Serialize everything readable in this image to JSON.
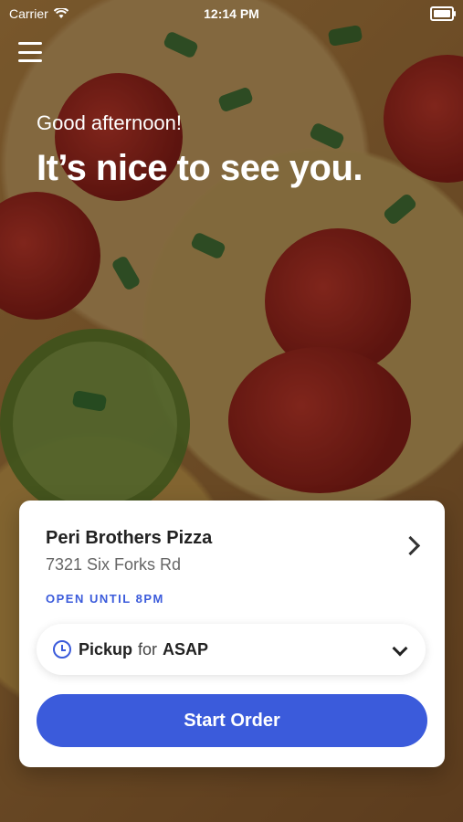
{
  "status_bar": {
    "carrier": "Carrier",
    "time": "12:14 PM"
  },
  "greeting": "Good afternoon!",
  "headline": "It’s nice to see you.",
  "store": {
    "name": "Peri Brothers Pizza",
    "address": "7321 Six Forks Rd",
    "hours": "OPEN UNTIL 8PM"
  },
  "order_mode": {
    "mode": "Pickup",
    "for_label": "for",
    "time": "ASAP"
  },
  "start_button_label": "Start Order",
  "colors": {
    "accent": "#3b5bdb",
    "card_bg": "#ffffff"
  }
}
